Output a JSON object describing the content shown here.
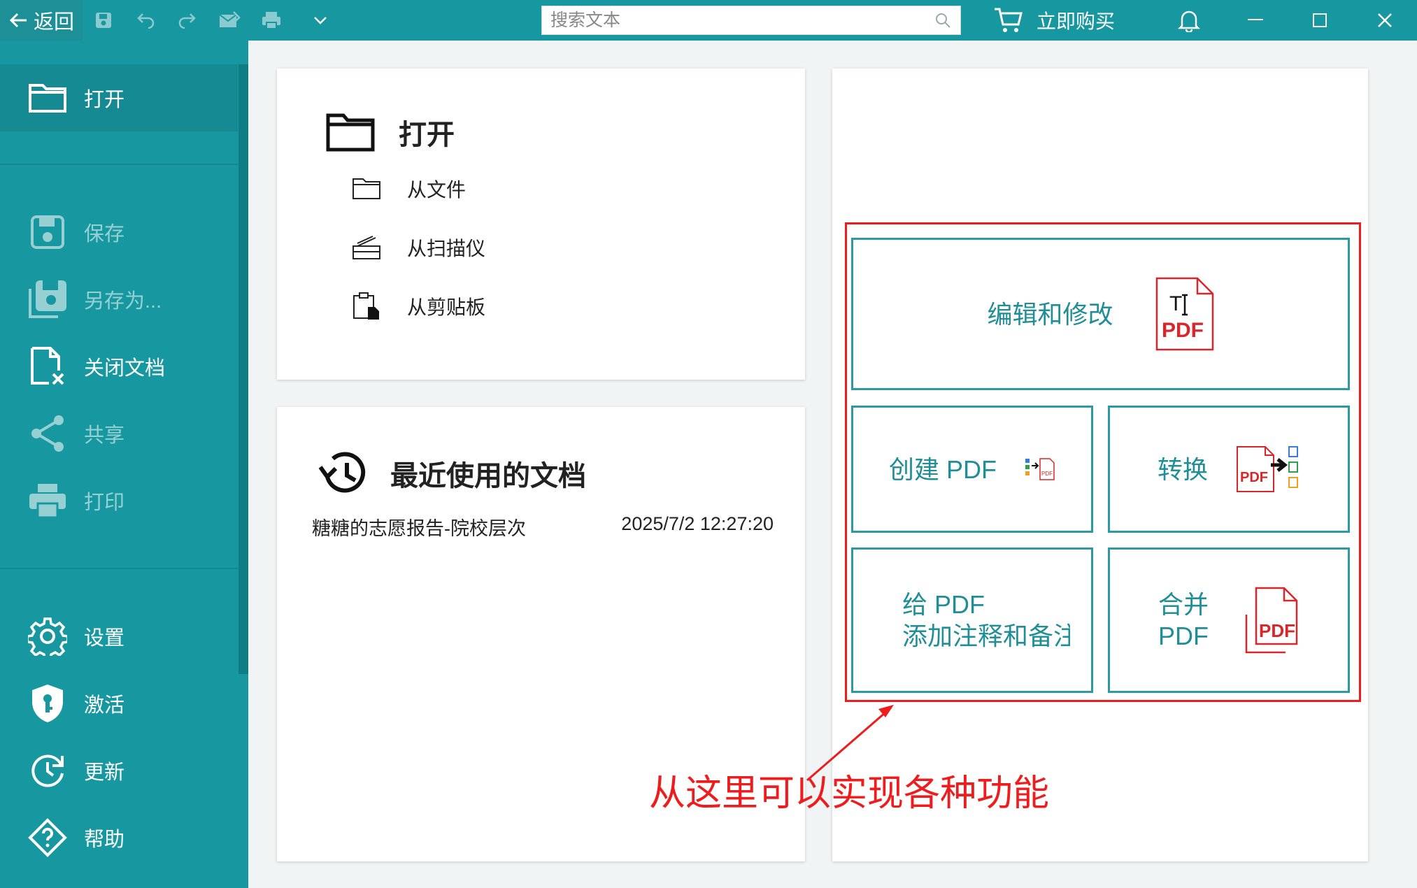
{
  "titlebar": {
    "back_label": "返回",
    "search_placeholder": "搜索文本",
    "buy_label": "立即购买",
    "icons": [
      "save-icon",
      "undo-icon",
      "redo-icon",
      "mail-icon",
      "print-icon",
      "chevron-down-icon",
      "search-icon",
      "cart-icon",
      "bell-icon",
      "minimize-icon",
      "maximize-icon",
      "close-icon"
    ]
  },
  "sidebar": {
    "items": [
      {
        "label": "打开",
        "icon": "folder-icon"
      },
      {
        "label": "保存",
        "icon": "save-icon"
      },
      {
        "label": "另存为...",
        "icon": "save-as-icon"
      },
      {
        "label": "关闭文档",
        "icon": "close-document-icon"
      },
      {
        "label": "共享",
        "icon": "share-icon"
      },
      {
        "label": "打印",
        "icon": "print-icon"
      },
      {
        "label": "设置",
        "icon": "gear-icon"
      },
      {
        "label": "激活",
        "icon": "key-shield-icon"
      },
      {
        "label": "更新",
        "icon": "update-icon"
      },
      {
        "label": "帮助",
        "icon": "help-icon"
      }
    ]
  },
  "open_panel": {
    "title": "打开",
    "items": [
      {
        "label": "从文件",
        "icon": "folder-icon"
      },
      {
        "label": "从扫描仪",
        "icon": "scanner-icon"
      },
      {
        "label": "从剪贴板",
        "icon": "clipboard-icon"
      }
    ]
  },
  "recent_panel": {
    "title": "最近使用的文档",
    "documents": [
      {
        "name": "糖糖的志愿报告-院校层次",
        "date": "2025/7/2 12:27:20"
      }
    ]
  },
  "functions": {
    "edit_label": "编辑和修改",
    "create_label": "创建 PDF",
    "convert_label": "转换",
    "annotate_line1": "给 PDF",
    "annotate_line2": "添加注释和备注",
    "merge_line1": "合并",
    "merge_line2": "PDF",
    "pdf_tag": "PDF"
  },
  "annotation": {
    "text": "从这里可以实现各种功能"
  },
  "colors": {
    "teal": "#17979f",
    "tile_border": "#2b9aa3",
    "pdf_red": "#d9262a",
    "annotation_red": "#ee1c1c"
  }
}
